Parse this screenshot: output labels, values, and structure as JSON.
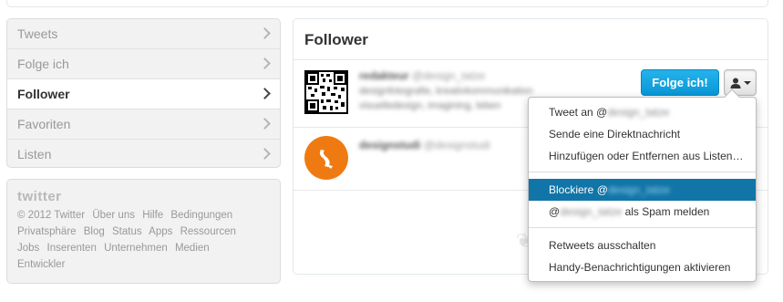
{
  "nav": {
    "items": [
      {
        "label": "Tweets",
        "active": false
      },
      {
        "label": "Folge ich",
        "active": false
      },
      {
        "label": "Follower",
        "active": true
      },
      {
        "label": "Favoriten",
        "active": false
      },
      {
        "label": "Listen",
        "active": false
      }
    ]
  },
  "footer": {
    "logo": "twitter",
    "links": [
      "© 2012 Twitter",
      "Über uns",
      "Hilfe",
      "Bedingungen",
      "Privatsphäre",
      "Blog",
      "Status",
      "Apps",
      "Ressourcen",
      "Jobs",
      "Inserenten",
      "Unternehmen",
      "Medien",
      "Entwickler"
    ]
  },
  "main": {
    "title": "Follower",
    "follow_button": "Folge ich!",
    "users": [
      {
        "avatar": "qr-code-image",
        "name_redacted": "redakteur",
        "handle_redacted": "@design_tatze",
        "bio_redacted": [
          "designfotografie, kreativkommunikation",
          "visuelledesign, imagining, leben"
        ]
      },
      {
        "avatar": "orange-logo",
        "name_redacted": "designstudi",
        "handle_redacted": "@designstudi"
      }
    ]
  },
  "dropdown": {
    "tweet_to": "Tweet an @",
    "tweet_to_redacted": "design_tatze",
    "direct_message": "Sende eine Direktnachricht",
    "lists": "Hinzufügen oder Entfernen aus Listen…",
    "block": "Blockiere @",
    "block_redacted": "design_tatze",
    "spam_prefix": "@",
    "spam_redacted": "design_tatze",
    "spam_suffix": " als Spam melden",
    "retweets_off": "Retweets ausschalten",
    "mobile_notifications": "Handy-Benachrichtigungen aktivieren"
  },
  "colors": {
    "follow_button": "#0a97d6",
    "highlight": "#1175a8",
    "avatar_orange": "#f07a12"
  }
}
